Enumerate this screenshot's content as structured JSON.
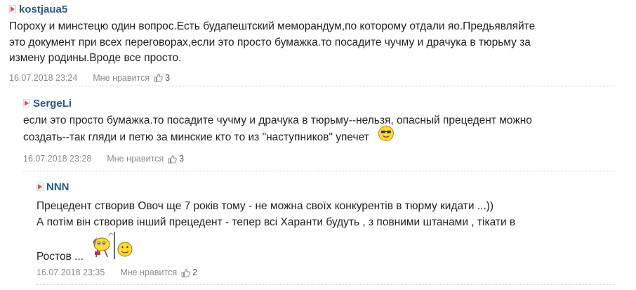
{
  "comments": [
    {
      "author": "kostjaua5",
      "lines": [
        "Пороху и минстецю один вопрос.Есть будапештский меморандум,по которому отдали яо.Предьявляйте",
        "это документ при всех переговорах,если это просто бумажка.то посадите чучму и драчука в тюрьму за",
        "измену родины.Вроде все просто."
      ],
      "date": "16.07.2018 23:24",
      "like_label": "Мне нравится",
      "likes": "3"
    },
    {
      "author": "SergeLi",
      "lines": [
        "если это просто бумажка.то посадите чучму и драчука в тюрьму--нельзя, опасный прецедент можно",
        "создать--так гляди и петю за минские кто то из \"наступников\" упечет"
      ],
      "emoticon": "cool-smiley",
      "date": "16.07.2018 23:28",
      "like_label": "Мне нравится",
      "likes": "3"
    },
    {
      "author": "NNN",
      "lines": [
        "Прецедент створив Овоч ще 7 років тому - не можна своїх конкурентів в тюрму кидати ...))",
        "А потім він створив інший прецедент - тепер всі Харанти будуть , з повними штанами , тікати в",
        "Ростов ..."
      ],
      "emoticon": "run-away-smiley",
      "date": "16.07.2018 23:35",
      "like_label": "Мне нравится",
      "likes": "2"
    }
  ],
  "icons": {
    "arrow": "expand-arrow-icon",
    "thumb": "thumbs-up-icon"
  },
  "colors": {
    "author": "#2a5a8a",
    "arrow": "#d9534f",
    "meta": "#8a8a8a"
  }
}
